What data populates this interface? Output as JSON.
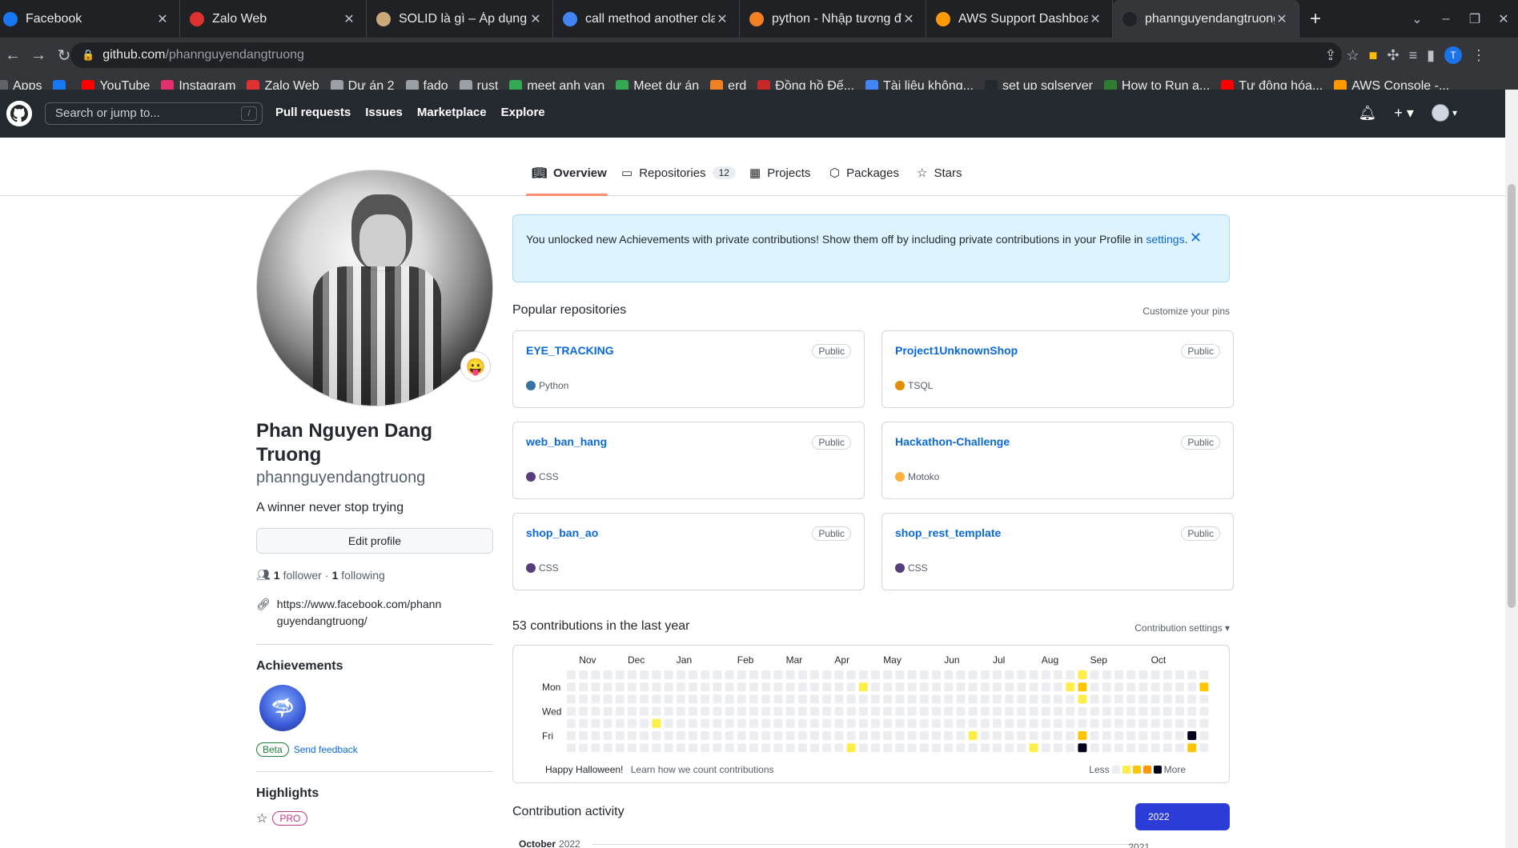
{
  "browser": {
    "tabs": [
      {
        "title": "Facebook",
        "color": "#1877f2",
        "icon": "facebook-icon"
      },
      {
        "title": "Zalo Web",
        "color": "#e03131",
        "icon": "zalo-icon"
      },
      {
        "title": "SOLID là gì – Áp dụng các",
        "color": "#c9a97a",
        "icon": "site-icon"
      },
      {
        "title": "call method another class",
        "color": "#4285f4",
        "icon": "google-icon"
      },
      {
        "title": "python - Nhập tương đối",
        "color": "#f48024",
        "icon": "stackoverflow-icon"
      },
      {
        "title": "AWS Support Dashboard",
        "color": "#ff9900",
        "icon": "aws-icon"
      },
      {
        "title": "phannguyendangtruong",
        "color": "#1f2328",
        "icon": "github-icon",
        "active": true
      }
    ],
    "url_host": "github.com",
    "url_path": "/phannguyendangtruong",
    "bookmarks": [
      {
        "label": "Apps",
        "color": "#5f6368"
      },
      {
        "label": "",
        "color": "#1877f2"
      },
      {
        "label": "YouTube",
        "color": "#ff0000"
      },
      {
        "label": "Instagram",
        "color": "#e1306c"
      },
      {
        "label": "Zalo Web",
        "color": "#e03131"
      },
      {
        "label": "Dự án 2",
        "color": "#9aa0a6"
      },
      {
        "label": "fado",
        "color": "#9aa0a6"
      },
      {
        "label": "rust",
        "color": "#9aa0a6"
      },
      {
        "label": "meet anh van",
        "color": "#34a853"
      },
      {
        "label": "Meet dự án",
        "color": "#34a853"
      },
      {
        "label": "erd",
        "color": "#f48024"
      },
      {
        "label": "Đồng hồ Đế...",
        "color": "#c62828"
      },
      {
        "label": "Tài liệu không...",
        "color": "#4285f4"
      },
      {
        "label": "set up sqlserver",
        "color": "#24292f"
      },
      {
        "label": "How to Run a...",
        "color": "#2e7d32"
      },
      {
        "label": "Tự động hóa...",
        "color": "#ff0000"
      },
      {
        "label": "AWS Console -...",
        "color": "#ff9900"
      }
    ]
  },
  "header": {
    "search_placeholder": "Search or jump to...",
    "slash": "/",
    "nav": [
      "Pull requests",
      "Issues",
      "Marketplace",
      "Explore"
    ]
  },
  "profile_tabs": {
    "overview": "Overview",
    "repositories": "Repositories",
    "repo_count": "12",
    "projects": "Projects",
    "packages": "Packages",
    "stars": "Stars"
  },
  "profile": {
    "name": "Phan Nguyen Dang Truong",
    "username": "phannguyendangtruong",
    "bio": "A winner never stop trying",
    "edit_label": "Edit profile",
    "followers": "1",
    "followers_label": "follower",
    "separator": "·",
    "following": "1",
    "following_label": "following",
    "website": "https://www.facebook.com/phannguyendangtruong/",
    "emoji": "😛",
    "achievements_title": "Achievements",
    "beta": "Beta",
    "feedback": "Send feedback",
    "highlights_title": "Highlights",
    "pro": "PRO"
  },
  "banner": {
    "text": "You unlocked new Achievements with private contributions! Show them off by including private contributions in your Profile in",
    "link": "settings",
    "period": "."
  },
  "popular": {
    "title": "Popular repositories",
    "customize": "Customize your pins",
    "repos": [
      {
        "name": "EYE_TRACKING",
        "visibility": "Public",
        "language": "Python",
        "color": "#3572A5"
      },
      {
        "name": "Project1UnknownShop",
        "visibility": "Public",
        "language": "TSQL",
        "color": "#e38c00"
      },
      {
        "name": "web_ban_hang",
        "visibility": "Public",
        "language": "CSS",
        "color": "#563d7c"
      },
      {
        "name": "Hackathon-Challenge",
        "visibility": "Public",
        "language": "Motoko",
        "color": "#fbb03b"
      },
      {
        "name": "shop_ban_ao",
        "visibility": "Public",
        "language": "CSS",
        "color": "#563d7c"
      },
      {
        "name": "shop_rest_template",
        "visibility": "Public",
        "language": "CSS",
        "color": "#563d7c"
      }
    ]
  },
  "contributions": {
    "title": "53 contributions in the last year",
    "settings": "Contribution settings ▾",
    "months": [
      {
        "label": "Nov",
        "week": 1
      },
      {
        "label": "Dec",
        "week": 5
      },
      {
        "label": "Jan",
        "week": 9
      },
      {
        "label": "Feb",
        "week": 14
      },
      {
        "label": "Mar",
        "week": 18
      },
      {
        "label": "Apr",
        "week": 22
      },
      {
        "label": "May",
        "week": 26
      },
      {
        "label": "Jun",
        "week": 31
      },
      {
        "label": "Jul",
        "week": 35
      },
      {
        "label": "Aug",
        "week": 39
      },
      {
        "label": "Sep",
        "week": 43
      },
      {
        "label": "Oct",
        "week": 48
      }
    ],
    "day_labels": [
      {
        "label": "Mon",
        "row": 1
      },
      {
        "label": "Wed",
        "row": 3
      },
      {
        "label": "Fri",
        "row": 5
      }
    ],
    "weeks": 53,
    "last_week_days": 7,
    "colors": [
      "#ebedf0",
      "#ffee4a",
      "#ffc501",
      "#fe9600",
      "#03001c"
    ],
    "active_cells": [
      {
        "week": 7,
        "day": 4,
        "level": 1
      },
      {
        "week": 23,
        "day": 6,
        "level": 1
      },
      {
        "week": 24,
        "day": 1,
        "level": 1
      },
      {
        "week": 33,
        "day": 5,
        "level": 1
      },
      {
        "week": 38,
        "day": 6,
        "level": 1
      },
      {
        "week": 41,
        "day": 1,
        "level": 1
      },
      {
        "week": 42,
        "day": 0,
        "level": 1
      },
      {
        "week": 42,
        "day": 1,
        "level": 2
      },
      {
        "week": 42,
        "day": 2,
        "level": 1
      },
      {
        "week": 42,
        "day": 5,
        "level": 2
      },
      {
        "week": 42,
        "day": 6,
        "level": 4
      },
      {
        "week": 51,
        "day": 5,
        "level": 4
      },
      {
        "week": 51,
        "day": 6,
        "level": 2
      },
      {
        "week": 52,
        "day": 1,
        "level": 2
      }
    ],
    "footer_text": "Happy Halloween!",
    "learn": "Learn how we count contributions",
    "less": "Less",
    "more": "More"
  },
  "activity": {
    "title": "Contribution activity",
    "year_selected": "2022",
    "year_next": "2021",
    "month": "October",
    "month_year": "2022"
  }
}
